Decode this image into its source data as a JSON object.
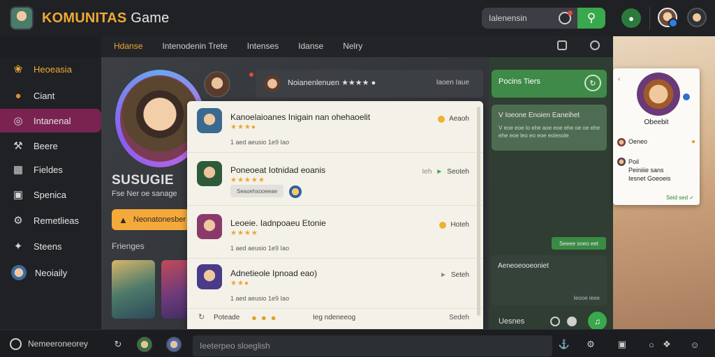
{
  "app": {
    "title_main": "KOMUNITAS",
    "title_sub": "Game"
  },
  "header": {
    "search_placeholder": "Ialenensin",
    "search_icon": "search-icon",
    "online_icon": "users-icon"
  },
  "tabs": [
    {
      "label": "Hdanse",
      "active": true
    },
    {
      "label": "Intenodenin Trete",
      "active": false
    },
    {
      "label": "Intenses",
      "active": false
    },
    {
      "label": "Idanse",
      "active": false
    },
    {
      "label": "Nelry",
      "active": false
    }
  ],
  "sidebar": {
    "items": [
      {
        "label": "Heoeasia",
        "icon": "leaf-icon"
      },
      {
        "label": "Ciant",
        "icon": "chat-icon"
      },
      {
        "label": "Intanenal",
        "icon": "target-icon",
        "active": true
      },
      {
        "label": "Beere",
        "icon": "hammer-icon"
      },
      {
        "label": "Fieldes",
        "icon": "grid-icon"
      },
      {
        "label": "Spenica",
        "icon": "console-icon"
      },
      {
        "label": "Remetlieas",
        "icon": "gear-icon"
      },
      {
        "label": "Steens",
        "icon": "tools-icon"
      },
      {
        "label": "Neoiaily",
        "icon": "avatar-icon"
      }
    ]
  },
  "profile": {
    "name": "SUSUGIE",
    "subtitle": "Fse Ner oe sanage",
    "follow_label": "Neonatonesber",
    "friends_label": "Frienges"
  },
  "peek_card": {
    "text": "Noianenlenuen ★★★★ ●",
    "right": "Iaoen Iaue"
  },
  "notifications": [
    {
      "title": "Kanoelaioanes Inigain nan ohehaoelit",
      "stars": "★★★●",
      "time": "1 aed aeusio 1e9 Iao",
      "action": "Aeaoh"
    },
    {
      "title": "Poneoeat Iotnidad eoanis",
      "stars": "★★★★★",
      "chip": "Seaoehsooeeae",
      "action_prefix": "Ieh",
      "action": "Seoteh"
    },
    {
      "title": "Leoeie. Iadnpoaeu Etonie",
      "stars": "★★★★",
      "time": "1 aed aeusio 1e9 Iao",
      "action": "Hoteh"
    },
    {
      "title": "Adnetieole Ipnoad eao)",
      "stars": "★★●",
      "time": "1 aed aeusio 1e9 Iao",
      "action": "Seteh"
    }
  ],
  "notif_footer": {
    "label": "Poteade",
    "text": "Ieg ndeneeog",
    "action": "Sedeh"
  },
  "group_chat": {
    "header": "Pocins Tiers",
    "card_title": "V Ioeone Enoien Eaneihet",
    "card_body": "V eoe eoe lo ehe aoe eoe ehe oe oe ehe ehe eoe leo eo eoe eoiesole",
    "pill": "Seeee soeo eet",
    "card2_title": "Aeneoeooeoniet",
    "card2_date": "Ieooe ieee",
    "footer_label": "Uesnes"
  },
  "popup": {
    "name": "Obeebit",
    "row1": "Oeneo",
    "row2_line1": "Poil",
    "row2_line2": "Peiniiie sans",
    "row2_line3": "Iesnet Goeoeis",
    "footer": "Seid sed ✓"
  },
  "bottom": {
    "status_label": "Nemeeroneorey",
    "input_placeholder": "Ieeterpeo sloeglish"
  },
  "colors": {
    "accent": "#f0a935",
    "active_nav": "#7a2350",
    "green": "#3aa84d"
  }
}
